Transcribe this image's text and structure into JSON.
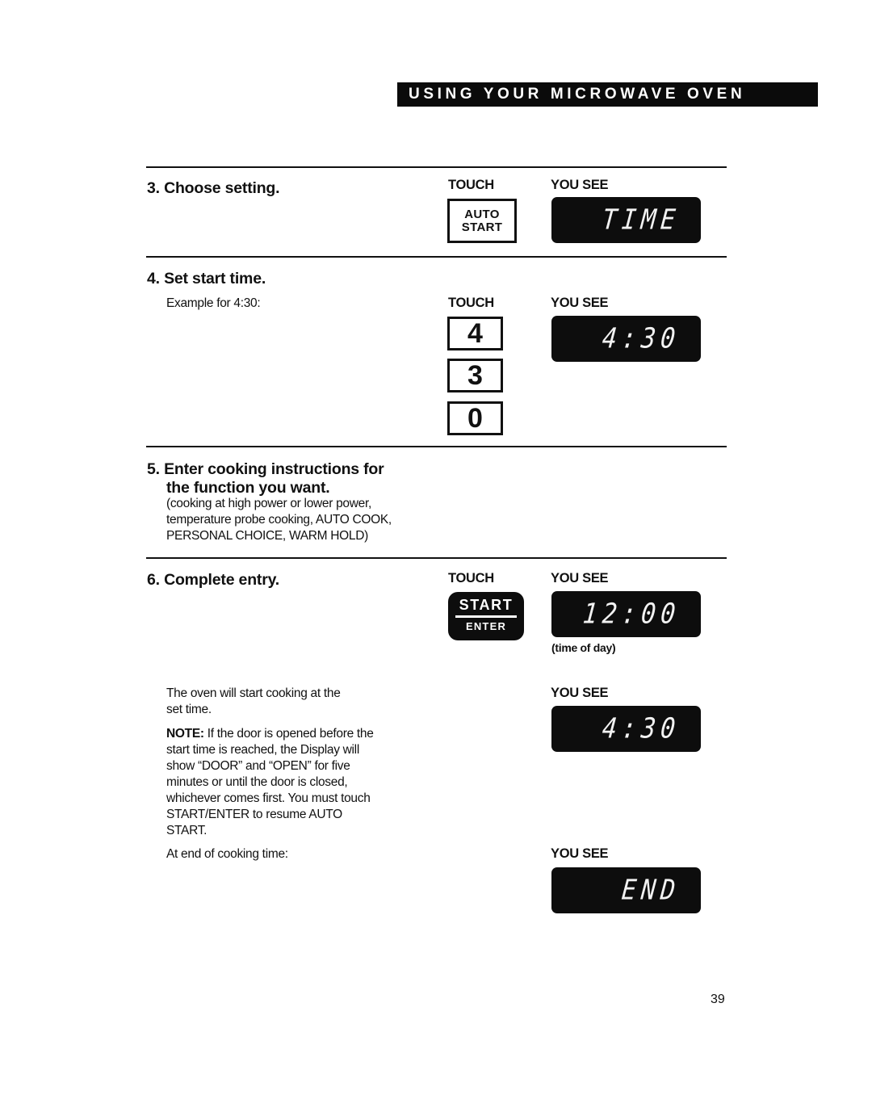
{
  "header": {
    "banner": "USING YOUR MICROWAVE OVEN"
  },
  "columns": {
    "touch": "TOUCH",
    "you_see": "YOU SEE"
  },
  "steps": [
    {
      "number": "3.",
      "title": "Choose setting.",
      "touch_key": {
        "line1": "AUTO",
        "line2": "START"
      },
      "display": "TIME"
    },
    {
      "number": "4.",
      "title": "Set start time.",
      "subtitle": "Example for 4:30:",
      "touch_keys": [
        "4",
        "3",
        "0"
      ],
      "display": "4:30"
    },
    {
      "number": "5.",
      "title_line1": "Enter cooking instructions for",
      "title_line2": "the function you want.",
      "desc_lines": [
        "(cooking at high power or lower power,",
        "temperature probe cooking, AUTO COOK,",
        "PERSONAL CHOICE, WARM HOLD)"
      ]
    },
    {
      "number": "6.",
      "title": "Complete entry.",
      "touch_key": {
        "line1": "START",
        "line2": "ENTER"
      },
      "display": "12:00",
      "display_caption": "(time of day)"
    }
  ],
  "after": {
    "start_text_lines": [
      "The oven will start cooking at the",
      "set time."
    ],
    "display_start": "4:30",
    "note_label": "NOTE:",
    "note_lines": [
      " If the door is opened before the",
      "start time is reached, the Display will",
      "show “DOOR” and “OPEN” for five",
      "minutes or until the door is closed,",
      "whichever comes first. You must touch",
      "START/ENTER to resume AUTO",
      "START."
    ],
    "end_text": "At end of cooking time:",
    "display_end": "END"
  },
  "page_number": "39"
}
